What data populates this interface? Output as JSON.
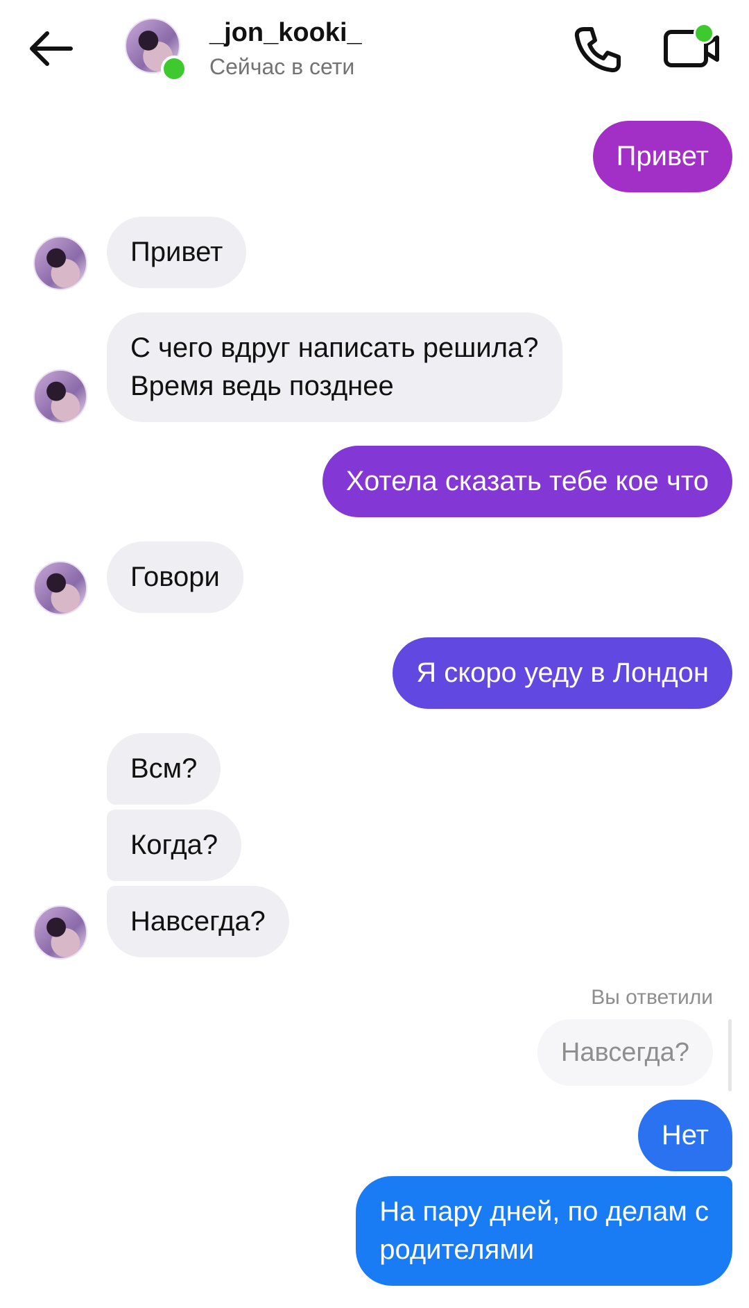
{
  "header": {
    "username": "_jon_kooki_",
    "status": "Сейчас в сети",
    "online_color": "#3ec92f",
    "icons": [
      "back-arrow-icon",
      "phone-icon",
      "video-camera-icon"
    ]
  },
  "messages": [
    {
      "from": "me",
      "text": "Привет"
    },
    {
      "from": "them",
      "text": "Привет"
    },
    {
      "from": "them",
      "line1": "С чего вдруг написать решила?",
      "line2": "Время ведь позднее"
    },
    {
      "from": "me",
      "text": "Хотела сказать тебе кое что"
    },
    {
      "from": "them",
      "text": "Говори"
    },
    {
      "from": "me",
      "text": "Я скоро уеду в Лондон"
    },
    {
      "from": "them",
      "text": "Всм?"
    },
    {
      "from": "them",
      "text": "Когда?"
    },
    {
      "from": "them",
      "text": "Навсегда?"
    },
    {
      "from": "me",
      "text": "Нет",
      "reply_label": "Вы ответили",
      "reply_quote": "Навсегда?"
    },
    {
      "from": "me",
      "line1": "На пару дней, по делам с",
      "line2": "родителями"
    }
  ],
  "colors": {
    "bubble_in": "#efeff3",
    "out_gradient": [
      "#a22fc6",
      "#7b3ee0",
      "#5a50ec",
      "#3e6ff2",
      "#1a7cf5"
    ]
  }
}
